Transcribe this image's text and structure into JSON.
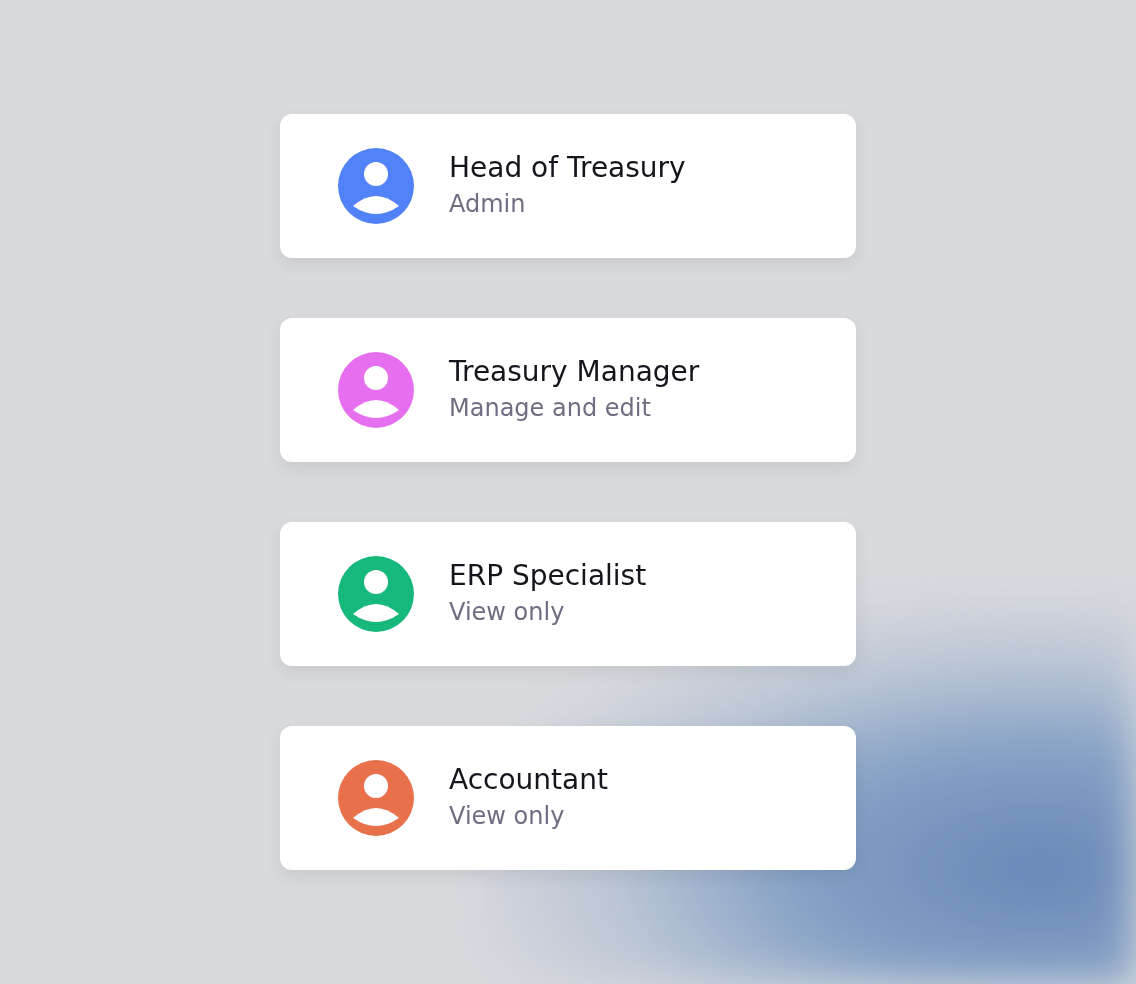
{
  "users": [
    {
      "name": "Head of Treasury",
      "role": "Admin",
      "color": "#5282fa"
    },
    {
      "name": "Treasury Manager",
      "role": "Manage and edit",
      "color": "#e56fef"
    },
    {
      "name": "ERP Specialist",
      "role": "View only",
      "color": "#17b87b"
    },
    {
      "name": "Accountant",
      "role": "View only",
      "color": "#e8704b"
    }
  ]
}
